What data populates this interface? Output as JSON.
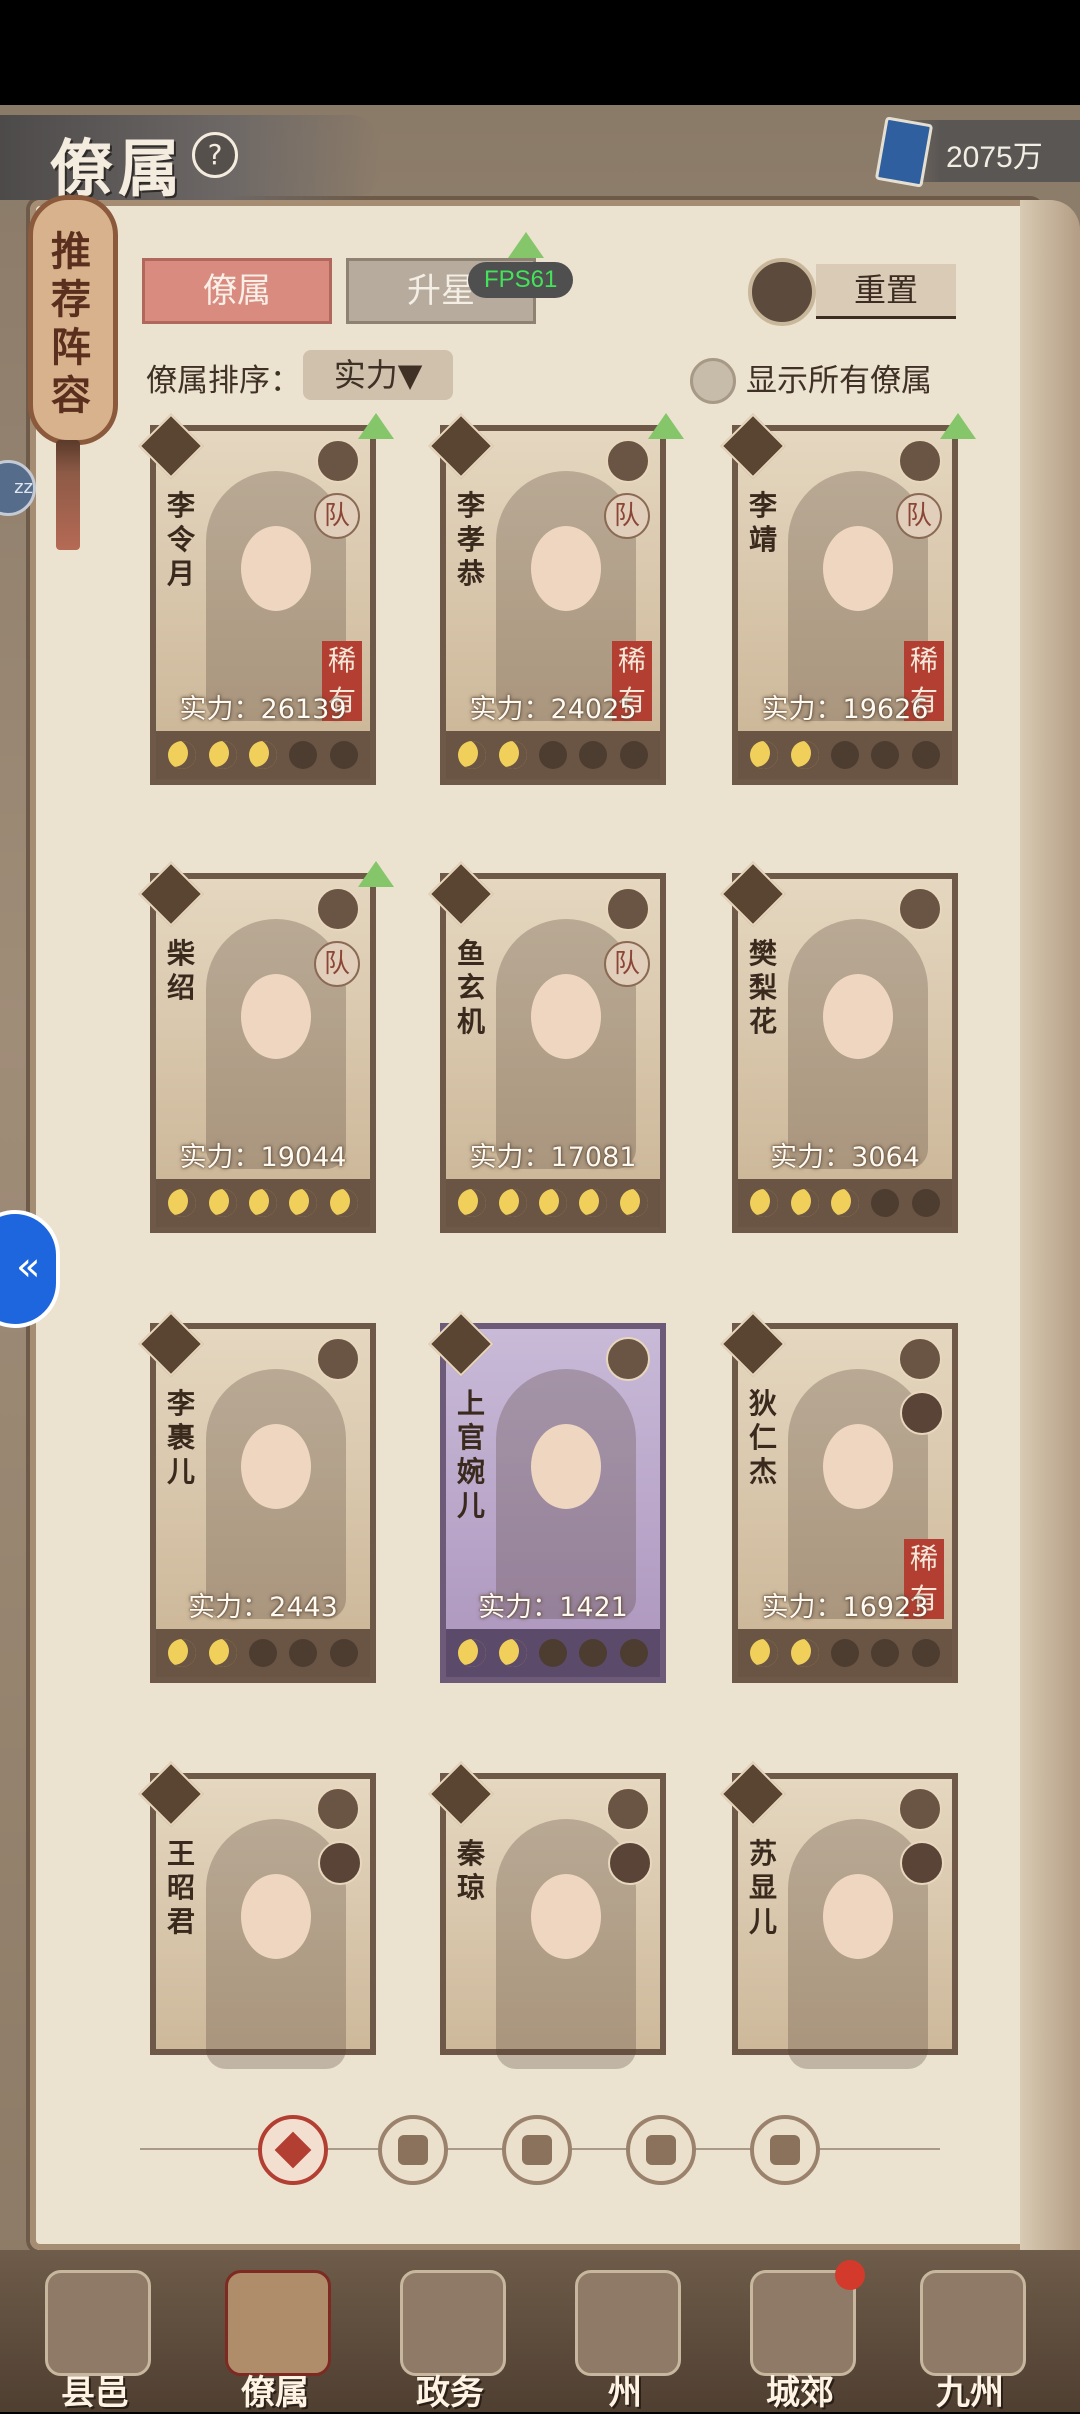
{
  "header": {
    "title": "僚属",
    "help_icon": "?",
    "currency_value": "2075万"
  },
  "side_panel": {
    "lineup_label": "推荐阵容",
    "left_bubble": "zz"
  },
  "tabs": [
    {
      "label": "僚属",
      "active": true
    },
    {
      "label": "升星",
      "active": false
    }
  ],
  "fps_overlay": "FPS61",
  "reset_label": "重置",
  "sort": {
    "label": "僚属排序：",
    "selected": "实力▼"
  },
  "show_all_label": "显示所有僚属",
  "cards": [
    {
      "name": "李令月",
      "power": "实力：26139",
      "stars": 3,
      "team": "队",
      "rare": "稀有",
      "upgrade": true,
      "purple": false,
      "avatar": false
    },
    {
      "name": "李孝恭",
      "power": "实力：24025",
      "stars": 2,
      "team": "队",
      "rare": "稀有",
      "upgrade": true,
      "purple": false,
      "avatar": false
    },
    {
      "name": "李靖",
      "power": "实力：19626",
      "stars": 2,
      "team": "队",
      "rare": "稀有",
      "upgrade": true,
      "purple": false,
      "avatar": false
    },
    {
      "name": "柴绍",
      "power": "实力：19044",
      "stars": 5,
      "team": "队",
      "rare": "",
      "upgrade": true,
      "purple": false,
      "avatar": false
    },
    {
      "name": "鱼玄机",
      "power": "实力：17081",
      "stars": 5,
      "team": "队",
      "rare": "",
      "upgrade": false,
      "purple": false,
      "avatar": false
    },
    {
      "name": "樊梨花",
      "power": "实力：3064",
      "stars": 3,
      "team": "",
      "rare": "",
      "upgrade": false,
      "purple": false,
      "avatar": false
    },
    {
      "name": "李裹儿",
      "power": "实力：2443",
      "stars": 2,
      "team": "",
      "rare": "",
      "upgrade": false,
      "purple": false,
      "avatar": false
    },
    {
      "name": "上官婉儿",
      "power": "实力：1421",
      "stars": 2,
      "team": "",
      "rare": "",
      "upgrade": false,
      "purple": true,
      "avatar": false
    },
    {
      "name": "狄仁杰",
      "power": "实力：16923",
      "stars": 2,
      "team": "",
      "rare": "稀有",
      "upgrade": false,
      "purple": false,
      "avatar": true
    },
    {
      "name": "王昭君",
      "power": "",
      "stars": 0,
      "team": "",
      "rare": "",
      "upgrade": false,
      "purple": false,
      "avatar": true
    },
    {
      "name": "秦琼",
      "power": "",
      "stars": 0,
      "team": "",
      "rare": "",
      "upgrade": false,
      "purple": false,
      "avatar": true
    },
    {
      "name": "苏显儿",
      "power": "",
      "stars": 0,
      "team": "",
      "rare": "",
      "upgrade": false,
      "purple": false,
      "avatar": true
    }
  ],
  "filters": [
    {
      "icon": "all-diamond-icon",
      "active": true
    },
    {
      "icon": "bell-icon",
      "active": false
    },
    {
      "icon": "cat-icon",
      "active": false
    },
    {
      "icon": "fan-icon",
      "active": false
    },
    {
      "icon": "lion-icon",
      "active": false
    }
  ],
  "bottom_nav": [
    {
      "label": "县邑",
      "active": false,
      "badge": false
    },
    {
      "label": "僚属",
      "active": true,
      "badge": false
    },
    {
      "label": "政务",
      "active": false,
      "badge": false
    },
    {
      "label": "州",
      "active": false,
      "badge": false
    },
    {
      "label": "城郊",
      "active": false,
      "badge": true
    },
    {
      "label": "九州",
      "active": false,
      "badge": false
    }
  ]
}
